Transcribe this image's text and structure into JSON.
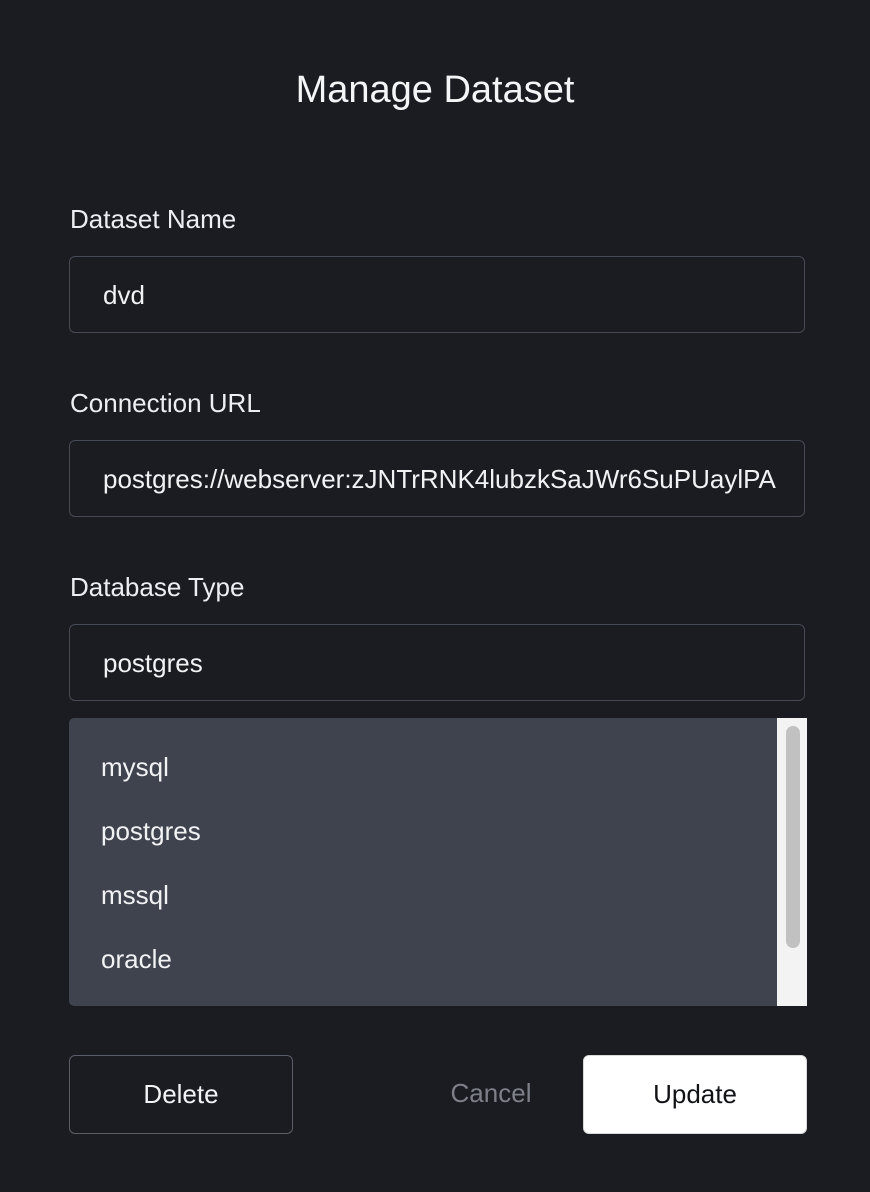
{
  "dialog": {
    "title": "Manage Dataset"
  },
  "form": {
    "dataset_name": {
      "label": "Dataset Name",
      "value": "dvd"
    },
    "connection_url": {
      "label": "Connection URL",
      "value": "postgres://webserver:zJNTrRNK4lubzkSaJWr6SuPUaylPA"
    },
    "database_type": {
      "label": "Database Type",
      "value": "postgres",
      "options": [
        "mysql",
        "postgres",
        "mssql",
        "oracle"
      ]
    }
  },
  "buttons": {
    "delete_label": "Delete",
    "cancel_label": "Cancel",
    "update_label": "Update"
  },
  "colors": {
    "background": "#1b1c22",
    "field_border": "#464a54",
    "dropdown_bg": "#3f434d",
    "primary_button_bg": "#ffffff",
    "muted_text": "#7d8089"
  }
}
